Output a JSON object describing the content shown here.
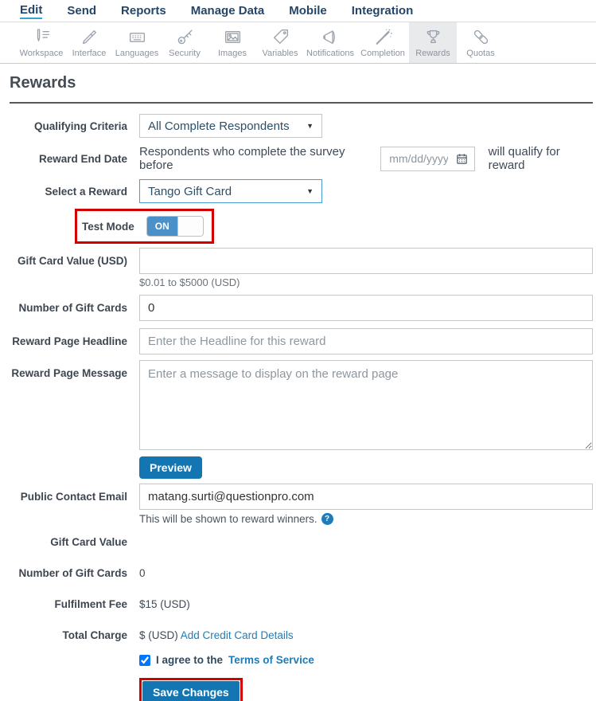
{
  "nav": {
    "items": [
      {
        "label": "Edit",
        "active": true
      },
      {
        "label": "Send",
        "active": false
      },
      {
        "label": "Reports",
        "active": false
      },
      {
        "label": "Manage Data",
        "active": false
      },
      {
        "label": "Mobile",
        "active": false
      },
      {
        "label": "Integration",
        "active": false
      }
    ]
  },
  "toolbar": {
    "items": [
      {
        "label": "Workspace",
        "icon": "workspace-icon",
        "active": false
      },
      {
        "label": "Interface",
        "icon": "interface-icon",
        "active": false
      },
      {
        "label": "Languages",
        "icon": "languages-icon",
        "active": false
      },
      {
        "label": "Security",
        "icon": "security-icon",
        "active": false
      },
      {
        "label": "Images",
        "icon": "images-icon",
        "active": false
      },
      {
        "label": "Variables",
        "icon": "variables-icon",
        "active": false
      },
      {
        "label": "Notifications",
        "icon": "notifications-icon",
        "active": false
      },
      {
        "label": "Completion",
        "icon": "completion-icon",
        "active": false
      },
      {
        "label": "Rewards",
        "icon": "rewards-icon",
        "active": true
      },
      {
        "label": "Quotas",
        "icon": "quotas-icon",
        "active": false
      }
    ]
  },
  "page": {
    "title": "Rewards"
  },
  "form": {
    "qualifying_criteria": {
      "label": "Qualifying Criteria",
      "value": "All Complete Respondents"
    },
    "reward_end_date": {
      "label": "Reward End Date",
      "prefix": "Respondents who complete the survey before",
      "placeholder": "mm/dd/yyyy",
      "suffix": "will qualify for reward"
    },
    "select_reward": {
      "label": "Select a Reward",
      "value": "Tango Gift Card"
    },
    "test_mode": {
      "label": "Test Mode",
      "state": "ON"
    },
    "gift_card_value": {
      "label": "Gift Card Value (USD)",
      "value": "",
      "help": "$0.01 to $5000 (USD)"
    },
    "num_gift_cards": {
      "label": "Number of Gift Cards",
      "value": "0"
    },
    "headline": {
      "label": "Reward Page Headline",
      "placeholder": "Enter the Headline for this reward"
    },
    "message": {
      "label": "Reward Page Message",
      "placeholder": "Enter a message to display on the reward page"
    },
    "preview_button": "Preview",
    "contact_email": {
      "label": "Public Contact Email",
      "value": "matang.surti@questionpro.com",
      "help": "This will be shown to reward winners."
    },
    "summary": [
      {
        "label": "Gift Card Value",
        "value": ""
      },
      {
        "label": "Number of Gift Cards",
        "value": "0"
      },
      {
        "label": "Fulfilment Fee",
        "value": "$15 (USD)"
      },
      {
        "label": "Total Charge",
        "value": "$ (USD)",
        "link": "Add Credit Card Details"
      }
    ],
    "agree": {
      "text": "I agree to the",
      "link": "Terms of Service",
      "checked": "checked"
    },
    "save_button": "Save Changes"
  },
  "colors": {
    "nav_navy": "#24466b",
    "accent_blue": "#1376b2",
    "toggle_blue": "#4a90c9",
    "link_blue": "#1e7cb8",
    "annotation_red": "#d40000",
    "icon_gray": "#9ba3ae",
    "active_tab_bg": "#e9eaec"
  }
}
